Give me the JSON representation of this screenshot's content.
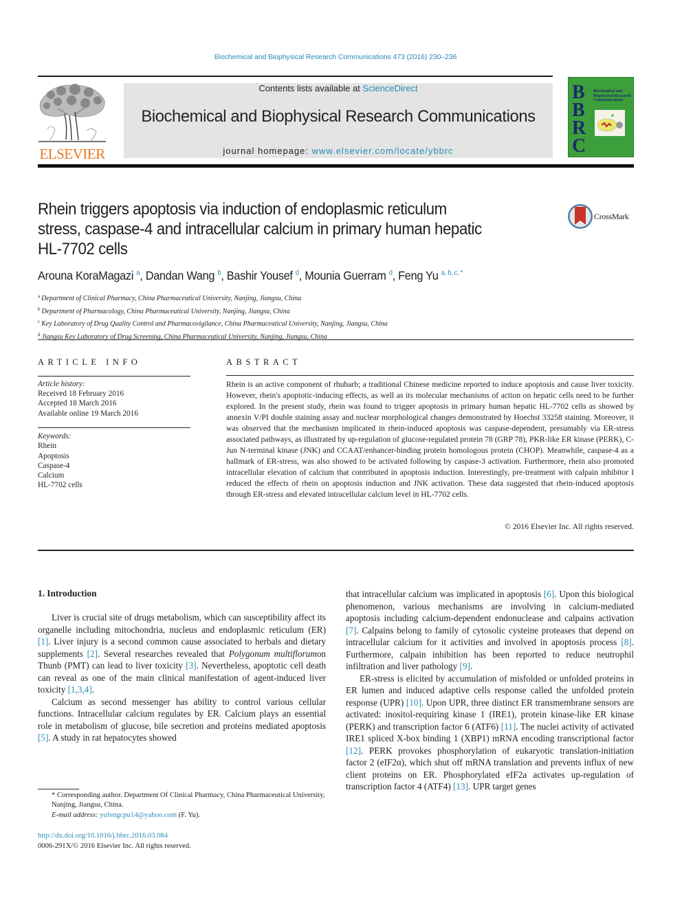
{
  "header": {
    "citation": "Biochemical and Biophysical Research Communications 473 (2016) 230–236",
    "contents_prefix": "Contents lists available at ",
    "contents_link": "ScienceDirect",
    "journal_title": "Biochemical and Biophysical Research Communications",
    "homepage_prefix": "journal homepage: ",
    "homepage_link": "www.elsevier.com/locate/ybbrc",
    "publisher_logo": "ELSEVIER",
    "cover": {
      "letters": [
        "B",
        "B",
        "R",
        "C"
      ],
      "title": "Biochemical and Biophysical Research Communications"
    },
    "colors": {
      "link": "#2a8ab5",
      "elsevier_orange": "#e8771c",
      "cover_green": "#3c9f3c",
      "banner_grey": "#e4e4e4"
    }
  },
  "article": {
    "title_lines": [
      "Rhein triggers apoptosis via induction of endoplasmic reticulum",
      "stress, caspase-4 and intracellular calcium in primary human hepatic",
      "HL-7702 cells"
    ],
    "crossmark": "CrossMark",
    "authors": [
      {
        "name": "Arouna KoraMagazi",
        "sup": "a"
      },
      {
        "name": "Dandan Wang",
        "sup": "b"
      },
      {
        "name": "Bashir Yousef",
        "sup": "d"
      },
      {
        "name": "Mounia Guerram",
        "sup": "d"
      },
      {
        "name": "Feng Yu",
        "sup": "a, b, c, *"
      }
    ],
    "affiliations": [
      {
        "key": "a",
        "text": "Department of Clinical Pharmacy, China Pharmaceutical University, Nanjing, Jiangsu, China"
      },
      {
        "key": "b",
        "text": "Department of Pharmacology, China Pharmaceutical University, Nanjing, Jiangsu, China"
      },
      {
        "key": "c",
        "text": "Key Laboratory of Drug Quality Control and Pharmacovigilance, China Pharmaceutical University, Nanjing, Jiangsu, China"
      },
      {
        "key": "d",
        "text": "Jiangsu Key Laboratory of Drug Screening, China Pharmaceutical University, Nanjing, Jiangsu, China"
      }
    ]
  },
  "article_info": {
    "heading": "ARTICLE INFO",
    "history_label": "Article history:",
    "history": [
      "Received 18 February 2016",
      "Accepted 18 March 2016",
      "Available online 19 March 2016"
    ],
    "keywords_label": "Keywords:",
    "keywords": [
      "Rhein",
      "Apoptosis",
      "Caspase-4",
      "Calcium",
      "HL-7702 cells"
    ]
  },
  "abstract": {
    "heading": "ABSTRACT",
    "text": "Rhein is an active component of rhubarb; a traditional Chinese medicine reported to induce apoptosis and cause liver toxicity. However, rhein's apoptotic-inducing effects, as well as its molecular mechanisms of action on hepatic cells need to be further explored. In the present study, rhein was found to trigger apoptosis in primary human hepatic HL-7702 cells as showed by annexin V/PI double staining assay and nuclear morphological changes demonstrated by Hoechst 33258 staining. Moreover, it was observed that the mechanism implicated in rhein-induced apoptosis was caspase-dependent, presumably via ER-stress associated pathways, as illustrated by up-regulation of glucose-regulated protein 78 (GRP 78), PKR-like ER kinase (PERK), C-Jun N-terminal kinase (JNK) and CCAAT/enhancer-binding protein homologous protein (CHOP). Meanwhile, caspase-4 as a hallmark of ER-stress, was also showed to be activated following by caspase-3 activation. Furthermore, rhein also promoted intracellular elevation of calcium that contributed in apoptosis induction. Interestingly, pre-treatment with calpain inhibitor I reduced the effects of rhein on apoptosis induction and JNK activation. These data suggested that rhein-induced apoptosis through ER-stress and elevated intracellular calcium level in HL-7702 cells.",
    "copyright": "© 2016 Elsevier Inc. All rights reserved."
  },
  "body": {
    "section_heading": "1.  Introduction",
    "left_paragraphs": [
      [
        {
          "t": "Liver is crucial site of drugs metabolism, which can susceptibility affect its organelle including mitochondria, nucleus and endoplasmic reticulum (ER) "
        },
        {
          "ref": "[1]"
        },
        {
          "t": ". Liver injury is a second common cause associated to herbals and dietary supplements "
        },
        {
          "ref": "[2]"
        },
        {
          "t": ". Several researches revealed that "
        },
        {
          "i": "Polygonum multiflorum"
        },
        {
          "t": "on Thunb (PMT) can lead to liver toxicity "
        },
        {
          "ref": "[3]"
        },
        {
          "t": ". Nevertheless, apoptotic cell death can reveal as one of the main clinical manifestation of agent-induced liver toxicity "
        },
        {
          "ref": "[1,3,4]"
        },
        {
          "t": "."
        }
      ],
      [
        {
          "t": "Calcium as second messenger has ability to control various cellular functions. Intracellular calcium regulates by ER. Calcium plays an essential role in metabolism of glucose, bile secretion and proteins mediated apoptosis "
        },
        {
          "ref": "[5]"
        },
        {
          "t": ". A study in rat hepatocytes showed"
        }
      ]
    ],
    "right_paragraphs": [
      [
        {
          "t": "that intracellular calcium was implicated in apoptosis "
        },
        {
          "ref": "[6]"
        },
        {
          "t": ". Upon this biological phenomenon, various mechanisms are involving in calcium-mediated apoptosis including calcium-dependent endonuclease and calpains activation "
        },
        {
          "ref": "[7]"
        },
        {
          "t": ". Calpains belong to family of cytosolic cysteine proteases that depend on intracellular calcium for it activities and involved in apoptosis process "
        },
        {
          "ref": "[8]"
        },
        {
          "t": ". Furthermore, calpain inhibition has been reported to reduce neutrophil infiltration and liver pathology "
        },
        {
          "ref": "[9]"
        },
        {
          "t": "."
        }
      ],
      [
        {
          "t": "ER-stress is elicited by accumulation of misfolded or unfolded proteins in ER lumen and induced adaptive cells response called the unfolded protein response (UPR) "
        },
        {
          "ref": "[10]"
        },
        {
          "t": ". Upon UPR, three distinct ER transmembrane sensors are activated: inositol-requiring kinase 1 (IRE1), protein kinase-like ER kinase (PERK) and transcription factor 6 (ATF6) "
        },
        {
          "ref": "[11]"
        },
        {
          "t": ". The nuclei activity of activated IRE1 spliced X-box binding 1 (XBP1) mRNA encoding transcriptional factor "
        },
        {
          "ref": "[12]"
        },
        {
          "t": ". PERK provokes phosphorylation of eukaryotic translation-initiation factor 2 (eIF2α), which shut off mRNA translation and prevents influx of new client proteins on ER. Phosphorylated eIF2a activates up-regulation of transcription factor 4 (ATF4) "
        },
        {
          "ref": "[13]"
        },
        {
          "t": ". UPR target genes"
        }
      ]
    ]
  },
  "footnote": {
    "corresponding": "* Corresponding author. Department Of Clinical Pharmacy, China Pharmaceutical University, Nanjing, Jiangsu, China.",
    "email_label": "E-mail address: ",
    "email": "yufengcpu14@yahoo.com",
    "email_suffix": " (F. Yu).",
    "doi": "http://dx.doi.org/10.1016/j.bbrc.2016.03.084",
    "issn": "0006-291X/© 2016 Elsevier Inc. All rights reserved."
  }
}
